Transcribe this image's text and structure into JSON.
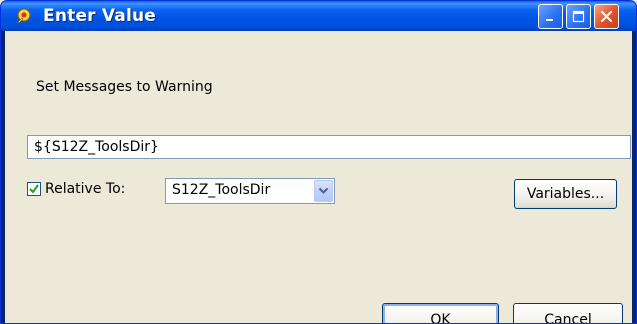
{
  "window": {
    "title": "Enter Value",
    "icon": "app-gear-icon"
  },
  "titlebar_buttons": {
    "minimize_icon": "minimize-icon",
    "maximize_icon": "maximize-icon",
    "close_icon": "close-icon"
  },
  "dialog": {
    "message": "Set Messages to Warning",
    "value": "${S12Z_ToolsDir}",
    "relative_checked": true,
    "relative_label": "Relative To:",
    "relative_to_value": "S12Z_ToolsDir",
    "variables_label": "Variables...",
    "ok_label": "OK",
    "cancel_label": "Cancel"
  },
  "colors": {
    "titlebar_blue": "#0054e3",
    "close_red": "#e0512b",
    "dialog_bg": "#ece9d8",
    "checkmark_green": "#21a121"
  }
}
